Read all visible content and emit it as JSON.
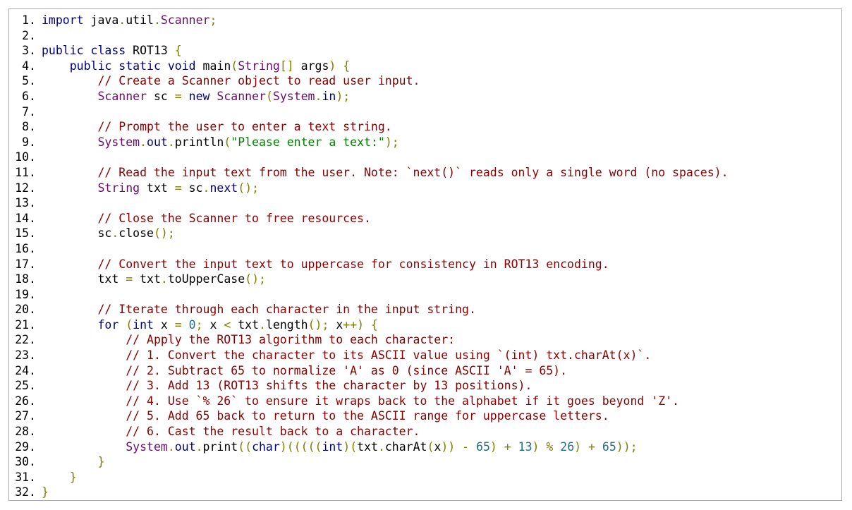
{
  "code_viewer": {
    "language": "java",
    "lines": [
      {
        "number": "1.",
        "text": "import java.util.Scanner;"
      },
      {
        "number": "2.",
        "text": ""
      },
      {
        "number": "3.",
        "text": "public class ROT13 {"
      },
      {
        "number": "4.",
        "text": "    public static void main(String[] args) {"
      },
      {
        "number": "5.",
        "text": "        // Create a Scanner object to read user input."
      },
      {
        "number": "6.",
        "text": "        Scanner sc = new Scanner(System.in);"
      },
      {
        "number": "7.",
        "text": ""
      },
      {
        "number": "8.",
        "text": "        // Prompt the user to enter a text string."
      },
      {
        "number": "9.",
        "text": "        System.out.println(\"Please enter a text:\");"
      },
      {
        "number": "10.",
        "text": ""
      },
      {
        "number": "11.",
        "text": "        // Read the input text from the user. Note: `next()` reads only a single word (no spaces)."
      },
      {
        "number": "12.",
        "text": "        String txt = sc.next();"
      },
      {
        "number": "13.",
        "text": ""
      },
      {
        "number": "14.",
        "text": "        // Close the Scanner to free resources."
      },
      {
        "number": "15.",
        "text": "        sc.close();"
      },
      {
        "number": "16.",
        "text": ""
      },
      {
        "number": "17.",
        "text": "        // Convert the input text to uppercase for consistency in ROT13 encoding."
      },
      {
        "number": "18.",
        "text": "        txt = txt.toUpperCase();"
      },
      {
        "number": "19.",
        "text": ""
      },
      {
        "number": "20.",
        "text": "        // Iterate through each character in the input string."
      },
      {
        "number": "21.",
        "text": "        for (int x = 0; x < txt.length(); x++) {"
      },
      {
        "number": "22.",
        "text": "            // Apply the ROT13 algorithm to each character:"
      },
      {
        "number": "23.",
        "text": "            // 1. Convert the character to its ASCII value using `(int) txt.charAt(x)`."
      },
      {
        "number": "24.",
        "text": "            // 2. Subtract 65 to normalize 'A' as 0 (since ASCII 'A' = 65)."
      },
      {
        "number": "25.",
        "text": "            // 3. Add 13 (ROT13 shifts the character by 13 positions)."
      },
      {
        "number": "26.",
        "text": "            // 4. Use `% 26` to ensure it wraps back to the alphabet if it goes beyond 'Z'."
      },
      {
        "number": "27.",
        "text": "            // 5. Add 65 back to return to the ASCII range for uppercase letters."
      },
      {
        "number": "28.",
        "text": "            // 6. Cast the result back to a character."
      },
      {
        "number": "29.",
        "text": "            System.out.print((char)(((((int)(txt.charAt(x)) - 65) + 13) % 26) + 65));"
      },
      {
        "number": "30.",
        "text": "        }"
      },
      {
        "number": "31.",
        "text": "    }"
      },
      {
        "number": "32.",
        "text": "}"
      }
    ]
  },
  "colors": {
    "keyword": "#00007f",
    "type": "#6a0d6a",
    "comment": "#8b0000",
    "string": "#007f00",
    "number": "#1f6f8b",
    "punctuation": "#7f7f00",
    "line_number": "#000000",
    "border": "#a9a9a9"
  }
}
